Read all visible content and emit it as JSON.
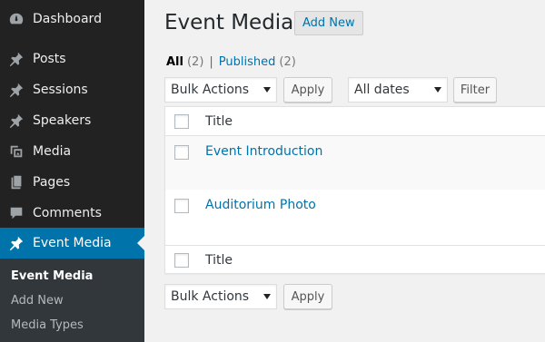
{
  "sidebar": {
    "items": [
      {
        "label": "Dashboard",
        "icon": "dashboard-icon"
      },
      {
        "label": "Posts",
        "icon": "pin-icon"
      },
      {
        "label": "Sessions",
        "icon": "pin-icon"
      },
      {
        "label": "Speakers",
        "icon": "pin-icon"
      },
      {
        "label": "Media",
        "icon": "media-icon"
      },
      {
        "label": "Pages",
        "icon": "pages-icon"
      },
      {
        "label": "Comments",
        "icon": "comments-icon"
      },
      {
        "label": "Event Media",
        "icon": "pin-icon"
      }
    ],
    "submenu": [
      {
        "label": "Event Media"
      },
      {
        "label": "Add New"
      },
      {
        "label": "Media Types"
      }
    ]
  },
  "header": {
    "title": "Event Media",
    "add_new": "Add New"
  },
  "filters": {
    "all_label": "All",
    "all_count": "(2)",
    "separator": "|",
    "published_label": "Published",
    "published_count": "(2)"
  },
  "toolbar_top": {
    "bulk_actions": "Bulk Actions",
    "apply": "Apply",
    "dates": "All dates",
    "filter": "Filter"
  },
  "table": {
    "column_title": "Title",
    "rows": [
      {
        "title": "Event Introduction"
      },
      {
        "title": "Auditorium Photo"
      }
    ],
    "footer_title": "Title"
  },
  "toolbar_bottom": {
    "bulk_actions": "Bulk Actions",
    "apply": "Apply"
  },
  "colors": {
    "sidebar_bg": "#222222",
    "active_bg": "#0073aa",
    "link": "#0073aa"
  }
}
